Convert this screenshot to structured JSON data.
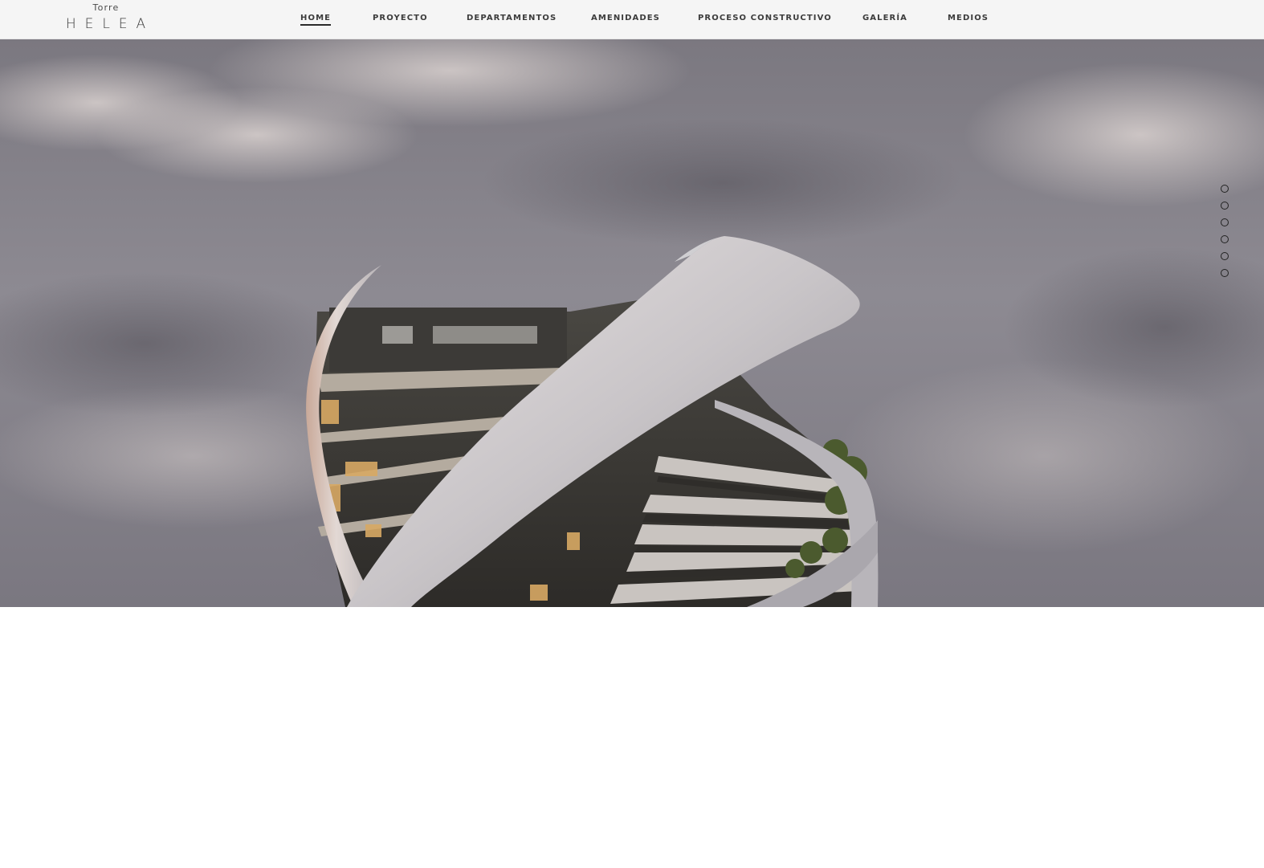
{
  "brand": {
    "small": "Torre",
    "big": "HELEA"
  },
  "nav": {
    "items": [
      {
        "label": "HOME",
        "active": true
      },
      {
        "label": "PROYECTO",
        "active": false
      },
      {
        "label": "DEPARTAMENTOS",
        "active": false
      },
      {
        "label": "AMENIDADES",
        "active": false
      },
      {
        "label": "PROCESO CONSTRUCTIVO",
        "active": false
      },
      {
        "label": "GALERÍA",
        "active": false
      },
      {
        "label": "MEDIOS",
        "active": false
      }
    ]
  },
  "slider": {
    "count": 6,
    "current": 1
  },
  "colors": {
    "topbar_bg": "#f5f5f5",
    "nav_text": "#3c3c3c",
    "sky": "#8a8790",
    "tower_white": "#d9d6da",
    "tower_dark": "#3b3935"
  }
}
